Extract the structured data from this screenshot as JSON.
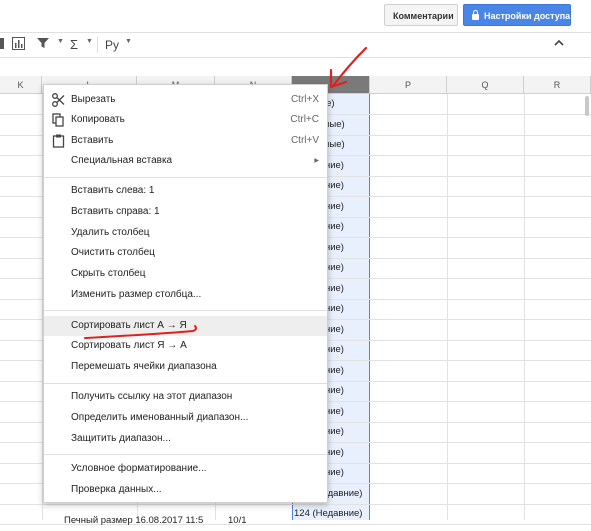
{
  "topbar": {
    "comments_label": "Комментарии",
    "share_label": "Настройки доступа"
  },
  "toolbar": {
    "sigma_label": "Σ",
    "input_tools_label": "Ру",
    "collapse_icon": "chevron-up-icon"
  },
  "columns": {
    "k": "K",
    "l": "L",
    "m": "M",
    "n": "N",
    "o": "",
    "p": "P",
    "q": "Q",
    "r": "R"
  },
  "column_o_cells": [
    "(Лучшие)",
    "(Реальные)",
    "(Реальные)",
    "(Недавние)",
    "(Недавние)",
    "(Недавние)",
    "(Недавние)",
    "(Недавние)",
    "(Недавние)",
    "(Недавние)",
    "(Недавние)",
    "(Недавние)",
    "(Недавние)",
    "(Недавние)",
    "(Недавние)",
    "(Недавние)",
    "(Недавние)",
    "(Недавние)",
    "(Недавние)",
    "124 (Недавние)",
    "124 (Недавние)"
  ],
  "bottom_row": {
    "cell_l": "Печный размер 16.08.2017 11:5",
    "cell_n": "10/1"
  },
  "context_menu": {
    "cut": {
      "label": "Вырезать",
      "shortcut": "Ctrl+X",
      "icon": "scissors-icon"
    },
    "copy": {
      "label": "Копировать",
      "shortcut": "Ctrl+C",
      "icon": "copy-icon"
    },
    "paste": {
      "label": "Вставить",
      "shortcut": "Ctrl+V",
      "icon": "clipboard-icon"
    },
    "paste_special": {
      "label": "Специальная вставка"
    },
    "insert_left": {
      "label": "Вставить слева: 1"
    },
    "insert_right": {
      "label": "Вставить справа: 1"
    },
    "delete_column": {
      "label": "Удалить столбец"
    },
    "clear_column": {
      "label": "Очистить столбец"
    },
    "hide_column": {
      "label": "Скрыть столбец"
    },
    "resize_column": {
      "label": "Изменить размер столбца..."
    },
    "sort_az": {
      "label": "Сортировать лист А → Я"
    },
    "sort_za": {
      "label": "Сортировать лист Я → А"
    },
    "shuffle": {
      "label": "Перемешать ячейки диапазона"
    },
    "get_link": {
      "label": "Получить ссылку на этот диапазон"
    },
    "named_range": {
      "label": "Определить именованный диапазон..."
    },
    "protect": {
      "label": "Защитить диапазон..."
    },
    "conditional_format": {
      "label": "Условное форматирование..."
    },
    "data_validation": {
      "label": "Проверка данных..."
    }
  },
  "colors": {
    "accent_blue": "#4a86e8",
    "annotation_red": "#e0211b",
    "selected_header": "#7a7a7a"
  }
}
